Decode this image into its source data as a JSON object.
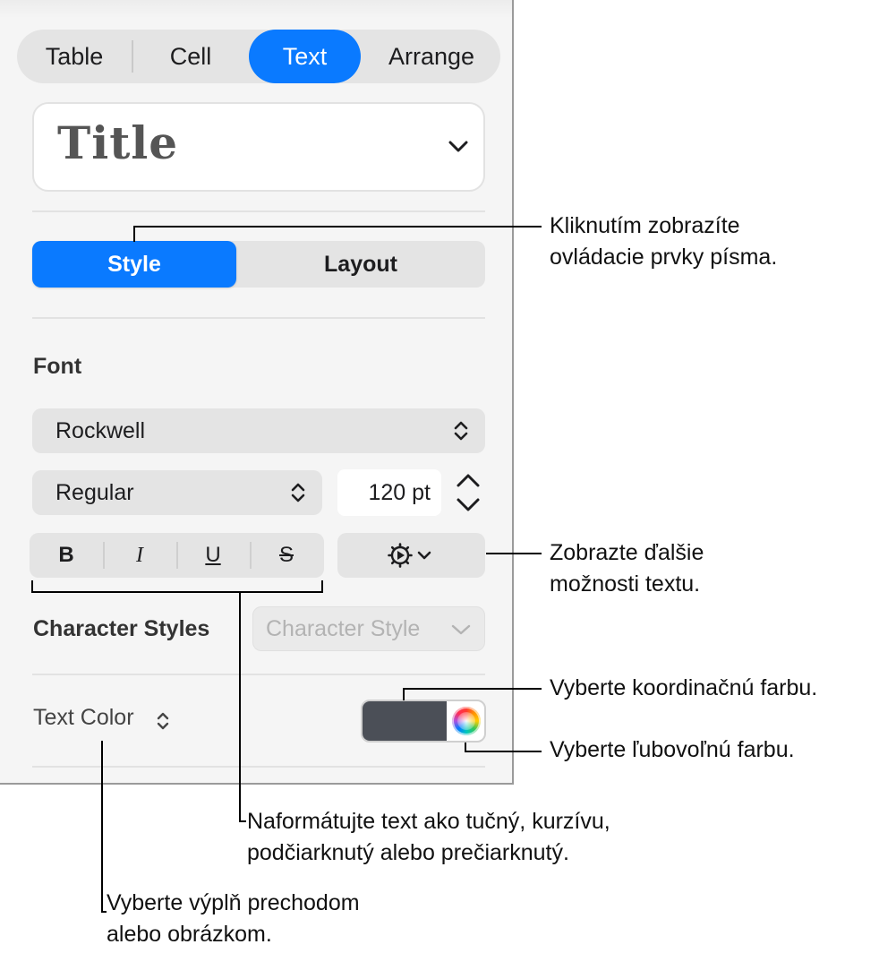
{
  "tabs": [
    "Table",
    "Cell",
    "Text",
    "Arrange"
  ],
  "active_tab": "Text",
  "paragraph_style": {
    "value": "Title"
  },
  "subtabs": {
    "style": "Style",
    "layout": "Layout"
  },
  "font": {
    "section_label": "Font",
    "family": "Rockwell",
    "typeface": "Regular",
    "size": "120 pt"
  },
  "format_buttons": {
    "bold": "B",
    "italic": "I",
    "underline": "U",
    "strike": "S"
  },
  "character_styles": {
    "label": "Character Styles",
    "placeholder": "Character Style"
  },
  "text_color": {
    "label": "Text Color",
    "swatch_color": "#4b4f57"
  },
  "accent_color": "#0a7aff",
  "callouts": {
    "style_tab": [
      "Kliknutím zobrazíte",
      "ovládacie prvky písma."
    ],
    "more_options": [
      "Zobrazte ďalšie",
      "možnosti textu."
    ],
    "coordinated_color": [
      "Vyberte koordinačnú farbu."
    ],
    "any_color": [
      "Vyberte ľubovoľnú farbu."
    ],
    "format": [
      "Naformátujte text ako tučný, kurzívu,",
      "podčiarknutý alebo prečiarknutý."
    ],
    "fill": [
      "Vyberte výplň prechodom",
      "alebo obrázkom."
    ]
  }
}
